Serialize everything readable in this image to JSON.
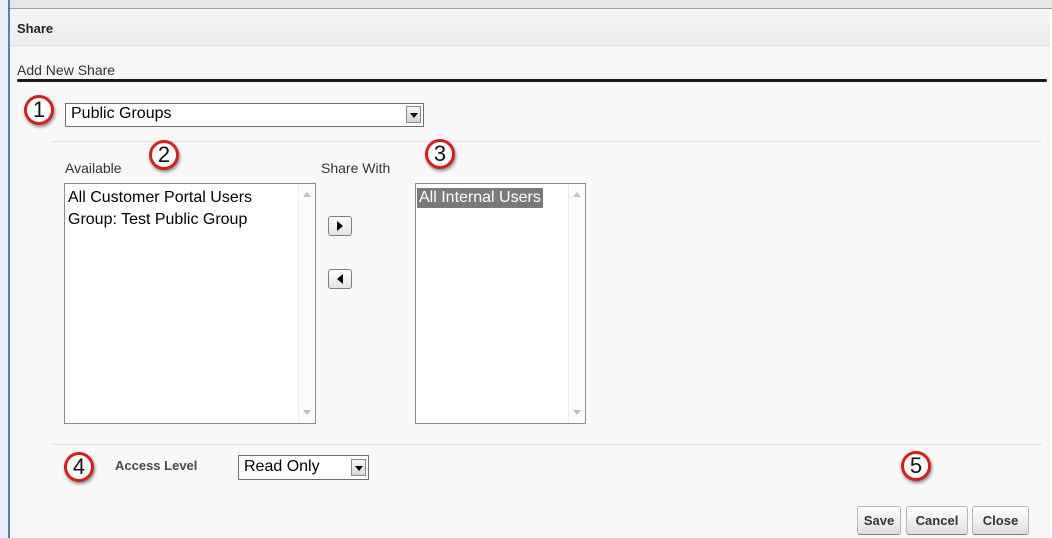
{
  "dialog": {
    "title": "Share",
    "section_title": "Add New Share"
  },
  "share_type": {
    "selected": "Public Groups"
  },
  "available": {
    "label": "Available",
    "items": [
      "All Customer Portal Users",
      "Group: Test Public Group"
    ]
  },
  "share_with": {
    "label": "Share With",
    "items": [
      "All Internal Users"
    ]
  },
  "access": {
    "label": "Access Level",
    "selected": "Read Only"
  },
  "buttons": {
    "save": "Save",
    "cancel": "Cancel",
    "close": "Close"
  },
  "callouts": [
    "1",
    "2",
    "3",
    "4",
    "5"
  ],
  "icons": {
    "add": "arrow-right-icon",
    "remove": "arrow-left-icon",
    "dropdown": "chevron-down-icon"
  },
  "colors": {
    "callout_border": "#d41f1f",
    "selected_item_bg": "#7a7a7a",
    "section_rule": "#1a1a1a"
  }
}
